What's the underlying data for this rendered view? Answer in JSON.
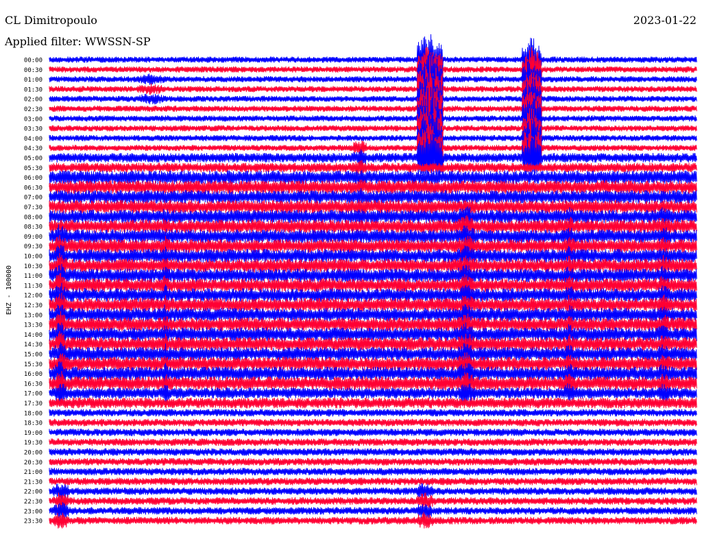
{
  "header": {
    "station": "CL Dimitropoulo",
    "date": "2023-01-22",
    "filter_label": "Applied filter:",
    "filter_name": "WWSSN-SP"
  },
  "chart_data": {
    "type": "line",
    "title": "",
    "ylabel": "EHZ - 100000",
    "xlabel": "",
    "grid": false,
    "legend": "none",
    "rows": [
      "00:00",
      "00:30",
      "01:00",
      "01:30",
      "02:00",
      "02:30",
      "03:00",
      "03:30",
      "04:00",
      "04:30",
      "05:00",
      "05:30",
      "06:00",
      "06:30",
      "07:00",
      "07:30",
      "08:00",
      "08:30",
      "09:00",
      "09:30",
      "10:00",
      "10:30",
      "11:00",
      "11:30",
      "12:00",
      "12:30",
      "13:00",
      "13:30",
      "14:00",
      "14:30",
      "15:00",
      "15:30",
      "16:00",
      "16:30",
      "17:00",
      "17:30",
      "18:00",
      "18:30",
      "19:00",
      "19:30",
      "20:00",
      "20:30",
      "21:00",
      "21:30",
      "22:00",
      "22:30",
      "23:00",
      "23:30"
    ],
    "colors": [
      "#0000ff",
      "#ff0033"
    ]
  }
}
